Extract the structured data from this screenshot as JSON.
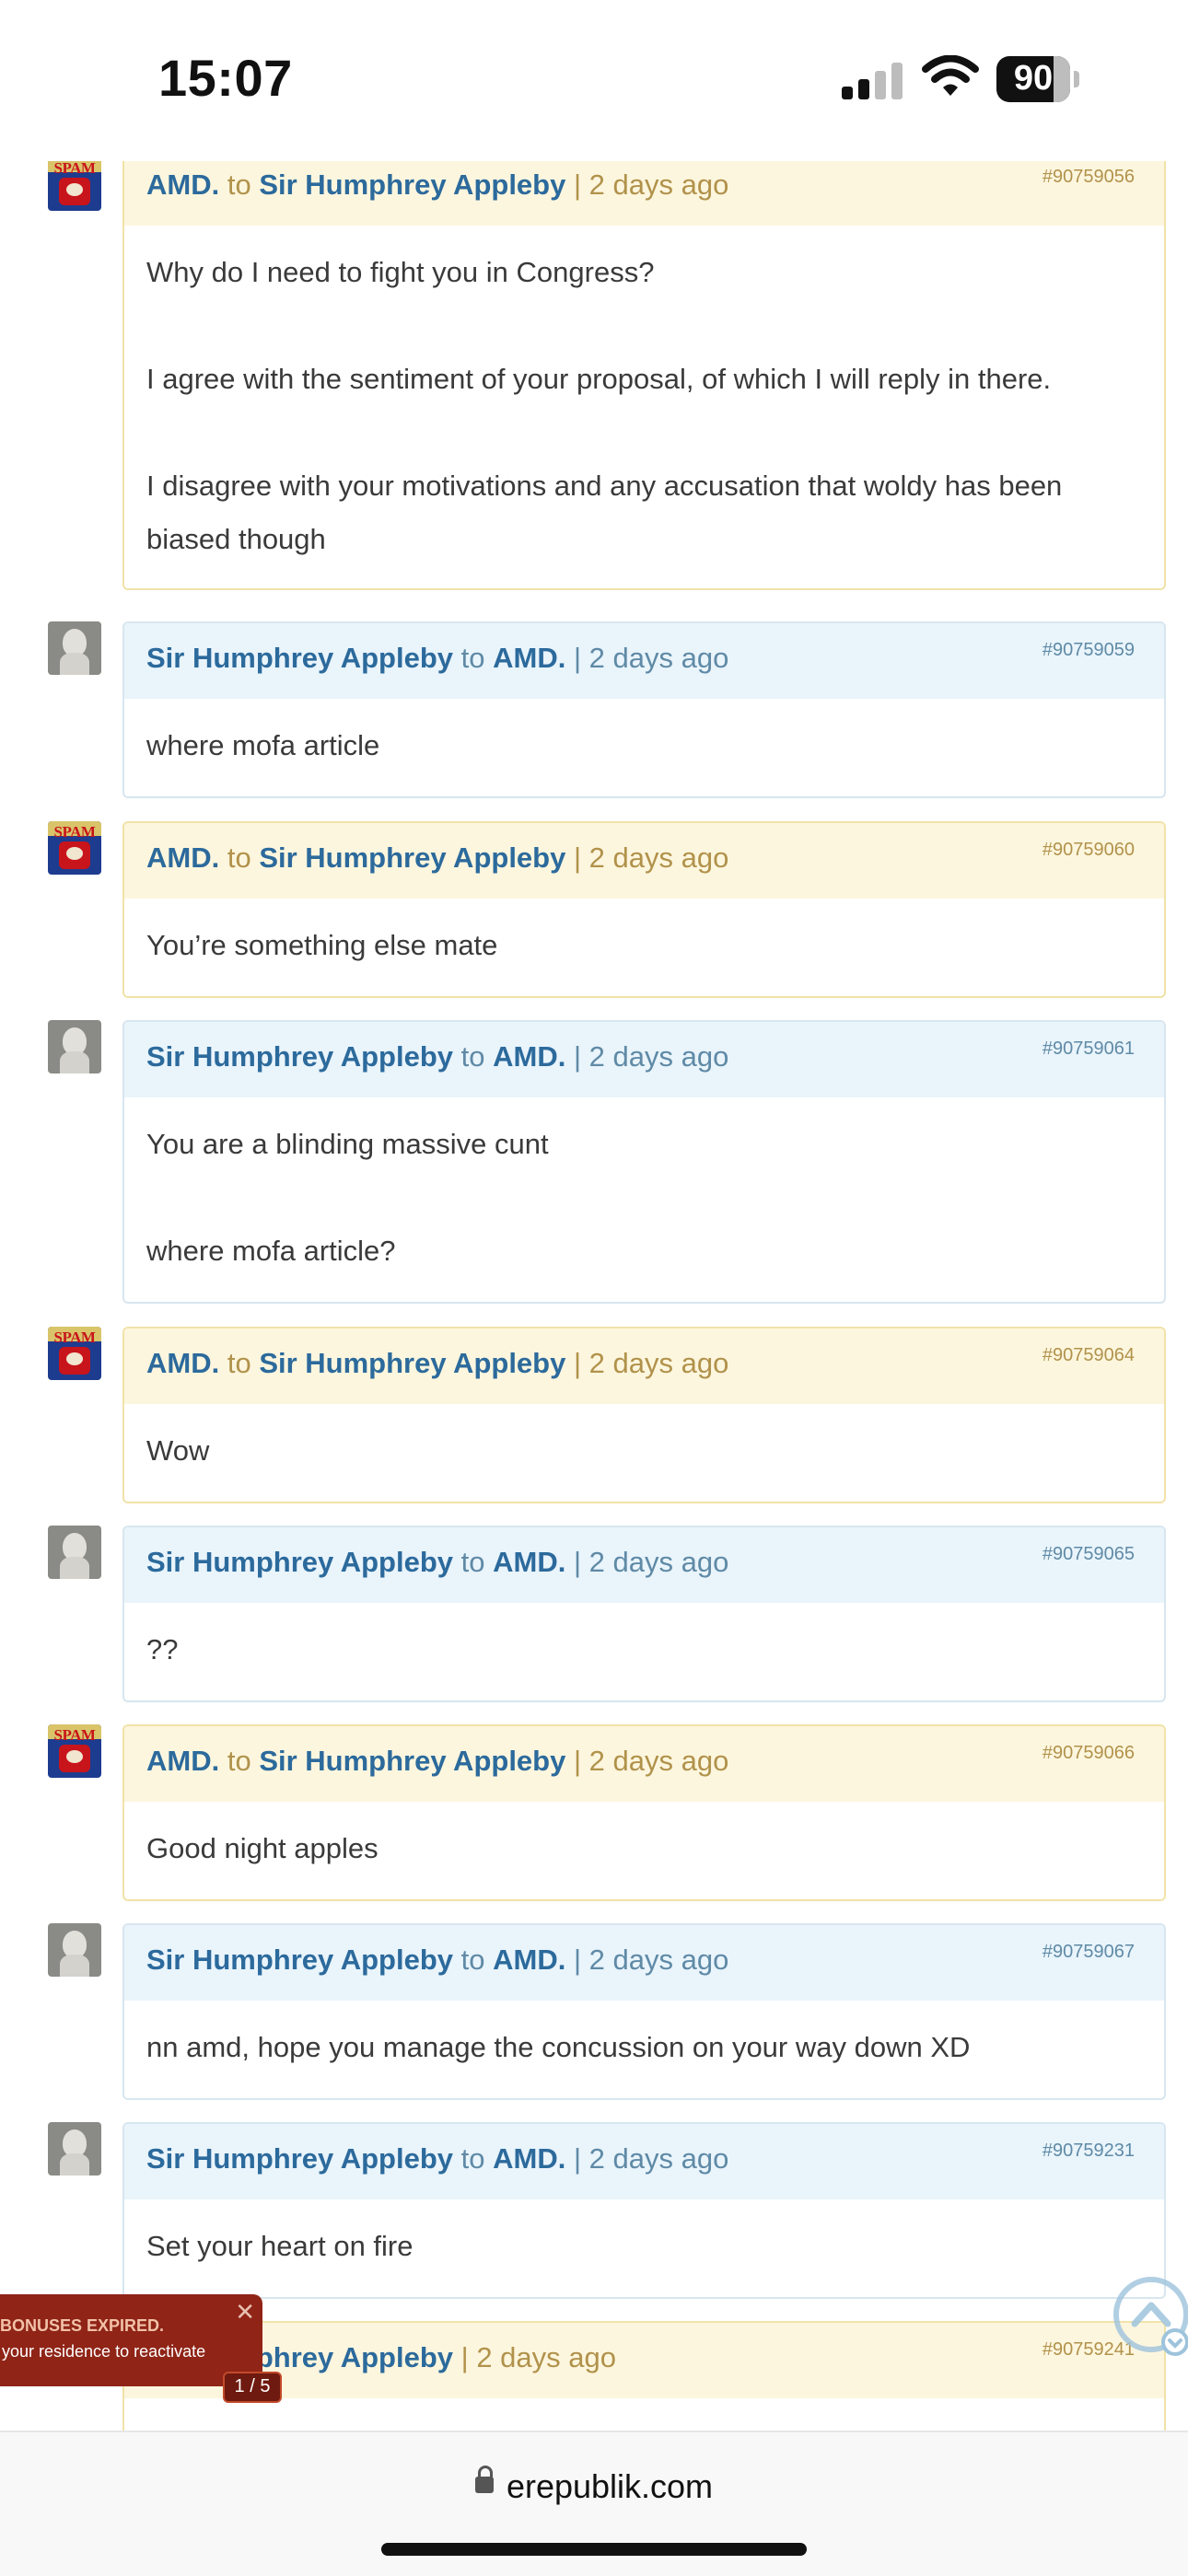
{
  "status_bar": {
    "time": "15:07",
    "battery": "90"
  },
  "comments": [
    {
      "id": "#90759056",
      "kind": "amd",
      "author": "AMD.",
      "to": "to",
      "target": "Sir Humphrey Appleby",
      "time": "| 2 days ago",
      "body": [
        "Why do I need to fight you in Congress?",
        "I agree with the sentiment of your proposal, of which I will reply in there.",
        "I disagree with your motivations and any accusation that woldy has been biased though"
      ]
    },
    {
      "id": "#90759059",
      "kind": "sir",
      "author": "Sir Humphrey Appleby",
      "to": "to",
      "target": "AMD.",
      "time": "| 2 days ago",
      "body": [
        "where mofa article"
      ]
    },
    {
      "id": "#90759060",
      "kind": "amd",
      "author": "AMD.",
      "to": "to",
      "target": "Sir Humphrey Appleby",
      "time": "| 2 days ago",
      "body": [
        "You’re something else mate"
      ]
    },
    {
      "id": "#90759061",
      "kind": "sir",
      "author": "Sir Humphrey Appleby",
      "to": "to",
      "target": "AMD.",
      "time": "| 2 days ago",
      "body": [
        "You are a blinding massive cunt",
        "where mofa article?"
      ]
    },
    {
      "id": "#90759064",
      "kind": "amd",
      "author": "AMD.",
      "to": "to",
      "target": "Sir Humphrey Appleby",
      "time": "| 2 days ago",
      "body": [
        "Wow"
      ]
    },
    {
      "id": "#90759065",
      "kind": "sir",
      "author": "Sir Humphrey Appleby",
      "to": "to",
      "target": "AMD.",
      "time": "| 2 days ago",
      "body": [
        "??"
      ]
    },
    {
      "id": "#90759066",
      "kind": "amd",
      "author": "AMD.",
      "to": "to",
      "target": "Sir Humphrey Appleby",
      "time": "| 2 days ago",
      "body": [
        "Good night apples"
      ]
    },
    {
      "id": "#90759067",
      "kind": "sir",
      "author": "Sir Humphrey Appleby",
      "to": "to",
      "target": "AMD.",
      "time": "| 2 days ago",
      "body": [
        "nn amd, hope you manage the concussion on your way down XD"
      ]
    },
    {
      "id": "#90759231",
      "kind": "sir",
      "author": "Sir Humphrey Appleby",
      "to": "to",
      "target": "AMD.",
      "time": "| 2 days ago",
      "body": [
        "Set your heart on fire"
      ]
    },
    {
      "id": "#90759241",
      "kind": "amd",
      "author": "",
      "to": "",
      "target": "Sir Humphrey Appleby",
      "time": "| 2 days ago",
      "body": []
    }
  ],
  "toast": {
    "line1": "BONUSES EXPIRED.",
    "line2": "your residence to reactivate",
    "pager": "1 / 5"
  },
  "browser": {
    "url": "erepublik.com"
  }
}
